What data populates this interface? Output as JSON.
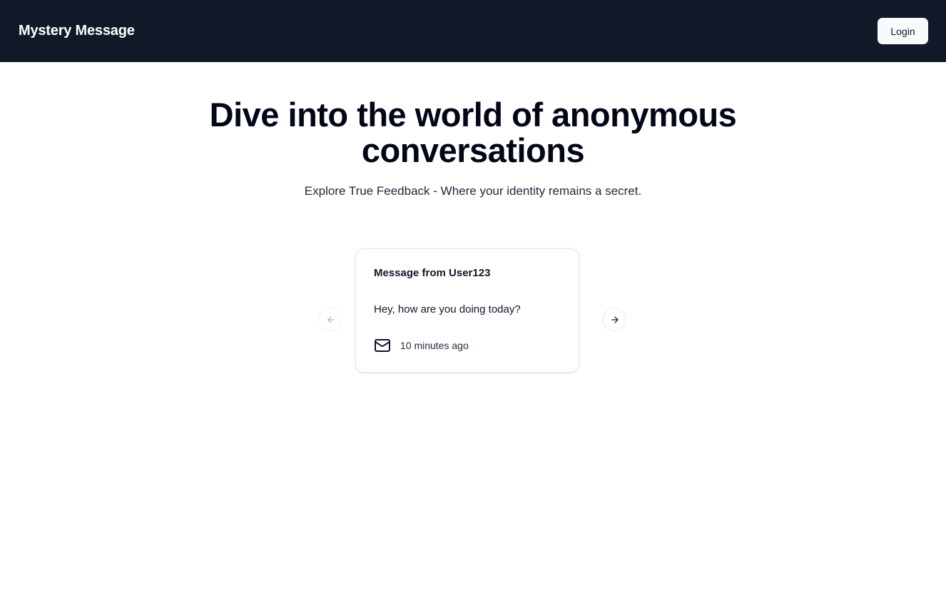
{
  "navbar": {
    "brand": "Mystery Message",
    "login_label": "Login",
    "background_color": "#111827"
  },
  "hero": {
    "title": "Dive into the world of anonymous conversations",
    "subtitle": "Explore True Feedback - Where your identity remains a secret."
  },
  "carousel": {
    "prev_icon": "arrow-left-icon",
    "next_icon": "arrow-right-icon",
    "messages": [
      {
        "title": "Message from User123",
        "content": "Hey, how are you doing today?",
        "received": "10 minutes ago",
        "icon": "mail-icon"
      }
    ]
  }
}
